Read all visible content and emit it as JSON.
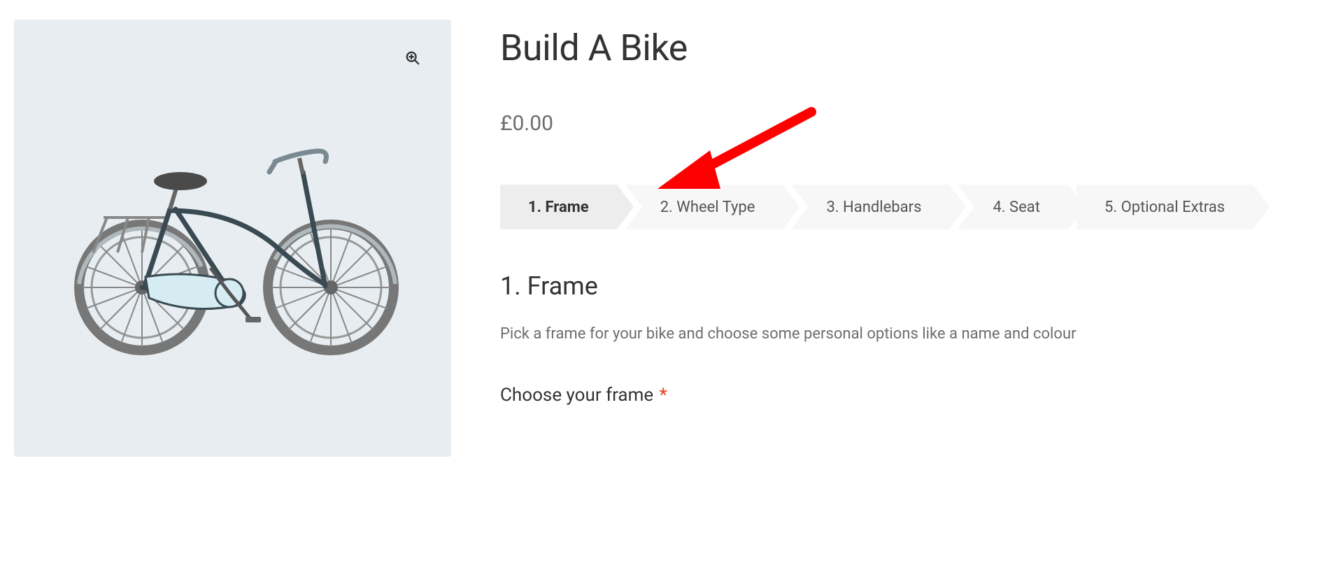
{
  "product": {
    "title": "Build A Bike",
    "price": "£0.00"
  },
  "steps": [
    {
      "label": "1. Frame",
      "active": true
    },
    {
      "label": "2. Wheel Type",
      "active": false
    },
    {
      "label": "3. Handlebars",
      "active": false
    },
    {
      "label": "4. Seat",
      "active": false
    },
    {
      "label": "5. Optional Extras",
      "active": false
    }
  ],
  "section": {
    "title": "1. Frame",
    "description": "Pick a frame for your bike and choose some personal options like a name and colour",
    "fieldLabel": "Choose your frame",
    "required": "*"
  },
  "icons": {
    "zoom": "zoom-in"
  }
}
